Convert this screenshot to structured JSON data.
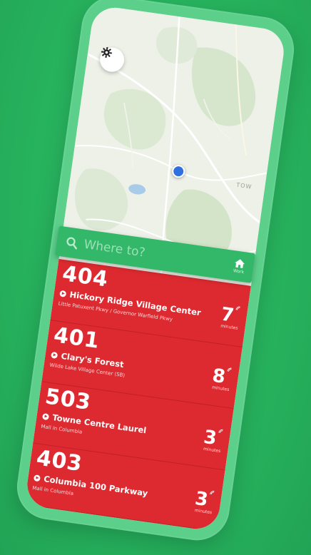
{
  "search": {
    "placeholder": "Where to?",
    "home_label": "Work"
  },
  "map": {
    "label": "TOW"
  },
  "arrivals": [
    {
      "route": "404",
      "destination": "Hickory Ridge Village Center",
      "stop": "Little Patuxent Pkwy / Governor Warfield Pkwy",
      "minutes": "7",
      "unit": "minutes"
    },
    {
      "route": "401",
      "destination": "Clary's Forest",
      "stop": "Wilde Lake Village Center (SB)",
      "minutes": "8",
      "unit": "minutes"
    },
    {
      "route": "503",
      "destination": "Towne Centre Laurel",
      "stop": "Mall in Columbia",
      "minutes": "3",
      "unit": "minutes"
    },
    {
      "route": "403",
      "destination": "Columbia 100 Parkway",
      "stop": "Mall in Columbia",
      "minutes": "3",
      "unit": "minutes"
    }
  ],
  "colors": {
    "background": "#27b35f",
    "frame": "#5ccf8b",
    "search_bar": "#33b86a",
    "arrival_red": "#dd2a30",
    "location_dot": "#2f6fe0"
  },
  "icons": {
    "settings": "gear-icon",
    "search": "search-icon",
    "home": "home-icon",
    "destination": "play-circle-icon",
    "realtime": "live-signal-icon"
  }
}
